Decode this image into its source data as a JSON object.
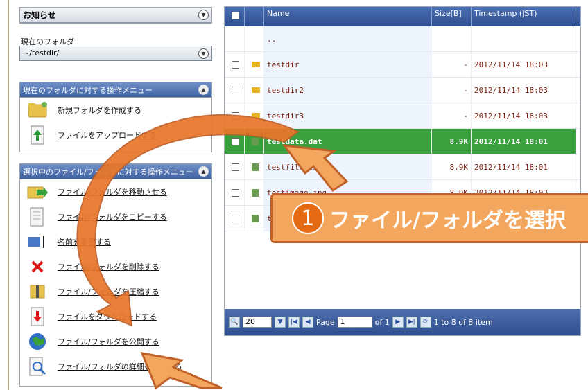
{
  "sidebar": {
    "notice_title": "お知らせ",
    "current_folder_label": "現在のフォルダ",
    "current_folder_path": "~/testdir/",
    "folder_menu_title": "現在のフォルダに対する操作メニュー",
    "folder_menu": [
      {
        "label": "新規フォルダを作成する",
        "icon": "new-folder-icon"
      },
      {
        "label": "ファイルをアップロードする",
        "icon": "upload-icon"
      }
    ],
    "selection_menu_title": "選択中のファイル/フォルダに対する操作メニュー",
    "selection_menu": [
      {
        "label": "ファイル/フォルダを移動させる",
        "icon": "move-icon"
      },
      {
        "label": "ファイル/フォルダをコピーする",
        "icon": "copy-icon"
      },
      {
        "label": "名前を変更する",
        "icon": "rename-icon"
      },
      {
        "label": "ファイル/フォルダを削除する",
        "icon": "delete-icon"
      },
      {
        "label": "ファイル/フォルダを圧縮する",
        "icon": "compress-icon"
      },
      {
        "label": "ファイルをダウンロードする",
        "icon": "download-icon"
      },
      {
        "label": "ファイル/フォルダを公開する",
        "icon": "publish-icon"
      },
      {
        "label": "ファイル/フォルダの詳細を表示する",
        "icon": "details-icon"
      }
    ]
  },
  "grid": {
    "columns": [
      "Name",
      "Size[B]",
      "Timestamp (JST)"
    ],
    "rows": [
      {
        "name": "..",
        "size": "",
        "time": "",
        "type": "parent",
        "selected": false
      },
      {
        "name": "testdir",
        "size": "-",
        "time": "2012/11/14 18:03",
        "type": "folder",
        "selected": false
      },
      {
        "name": "testdir2",
        "size": "-",
        "time": "2012/11/14 18:03",
        "type": "folder",
        "selected": false
      },
      {
        "name": "testdir3",
        "size": "-",
        "time": "2012/11/14 18:03",
        "type": "folder",
        "selected": false
      },
      {
        "name": "testdata.dat",
        "size": "8.9K",
        "time": "2012/11/14 18:01",
        "type": "file",
        "selected": true
      },
      {
        "name": "testfile.txt",
        "size": "8.9K",
        "time": "2012/11/14 18:01",
        "type": "file",
        "selected": false
      },
      {
        "name": "testimage.jpg",
        "size": "8.9K",
        "time": "2012/11/14 18:02",
        "type": "file",
        "selected": false
      },
      {
        "name": "test.zip",
        "size": "",
        "time": "",
        "type": "file",
        "selected": false
      }
    ]
  },
  "pager": {
    "page_size": "20",
    "page_label": "Page",
    "page_value": "1",
    "of_label": "of 1",
    "summary": "1 to 8 of 8 item"
  },
  "callout": {
    "number": "1",
    "text": "ファイル/フォルダを選択"
  },
  "colors": {
    "accent_orange": "#e8762a",
    "selected_row": "#3aa03e",
    "header_blue": "#2f4f8f"
  }
}
